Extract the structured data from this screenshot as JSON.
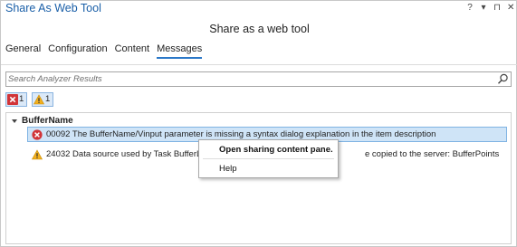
{
  "window": {
    "title": "Share As Web Tool",
    "controls": [
      "?",
      "▾",
      "⊓",
      "✕"
    ]
  },
  "subtitle": "Share as a web tool",
  "tabs": [
    {
      "label": "General"
    },
    {
      "label": "Configuration"
    },
    {
      "label": "Content"
    },
    {
      "label": "Messages",
      "active": true
    }
  ],
  "search": {
    "placeholder": "Search Analyzer Results"
  },
  "filters": {
    "errors": {
      "count": "1",
      "icon": "error-icon"
    },
    "warnings": {
      "count": "1",
      "icon": "warning-icon"
    }
  },
  "results": {
    "group_label": "BufferName",
    "rows": [
      {
        "type": "error",
        "icon": "error-icon",
        "text": "00092 The BufferName/Vinput parameter is missing a syntax dialog explanation in the item description",
        "selected": true
      },
      {
        "type": "warning",
        "icon": "warning-icon",
        "text_before": "24032 Data source used by Task BufferLabel i",
        "text_after": "e copied to the server: BufferPoints"
      }
    ]
  },
  "context_menu": {
    "items": [
      {
        "label": "Open sharing content pane."
      },
      {
        "label": "Help"
      }
    ]
  },
  "colors": {
    "title": "#1a5fa8",
    "accent": "#2b78c8",
    "selection": "#cfe4f7",
    "error": "#d13438",
    "warning": "#f2b01e"
  }
}
